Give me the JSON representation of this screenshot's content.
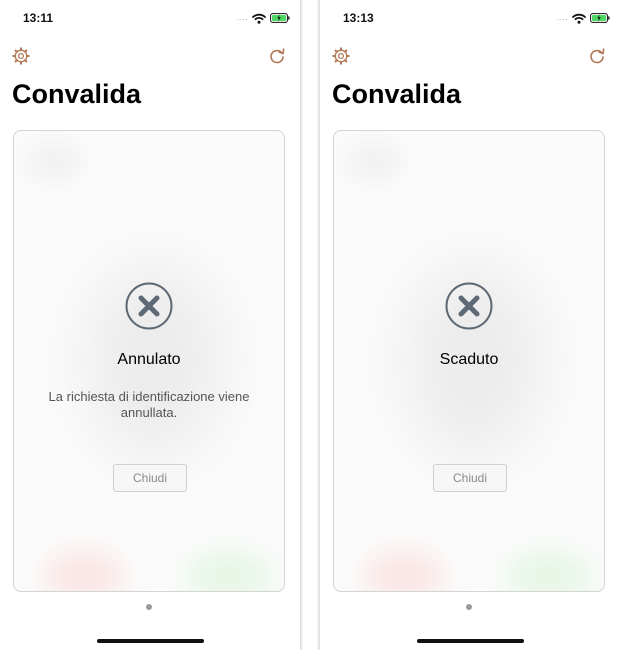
{
  "accent_color": "#b07a57",
  "icon_color": "#5d6a75",
  "screens": [
    {
      "status_bar": {
        "time": "13:11",
        "signal": "....",
        "icons": [
          "signal-dots-icon",
          "wifi-icon",
          "battery-charging-icon"
        ]
      },
      "toolbar": {
        "left_icon": "gear-icon",
        "right_icon": "refresh-icon"
      },
      "title": "Convalida",
      "card": {
        "status_icon": "close-circle-icon",
        "status_title": "Annulato",
        "message": "La richiesta di identificazione viene annullata.",
        "button_label": "Chiudi"
      },
      "page_indicator": {
        "current": 1,
        "total": 1
      }
    },
    {
      "status_bar": {
        "time": "13:13",
        "signal": "....",
        "icons": [
          "signal-dots-icon",
          "wifi-icon",
          "battery-charging-icon"
        ]
      },
      "toolbar": {
        "left_icon": "gear-icon",
        "right_icon": "refresh-icon"
      },
      "title": "Convalida",
      "card": {
        "status_icon": "close-circle-icon",
        "status_title": "Scaduto",
        "message": "",
        "button_label": "Chiudi"
      },
      "page_indicator": {
        "current": 1,
        "total": 1
      }
    }
  ]
}
